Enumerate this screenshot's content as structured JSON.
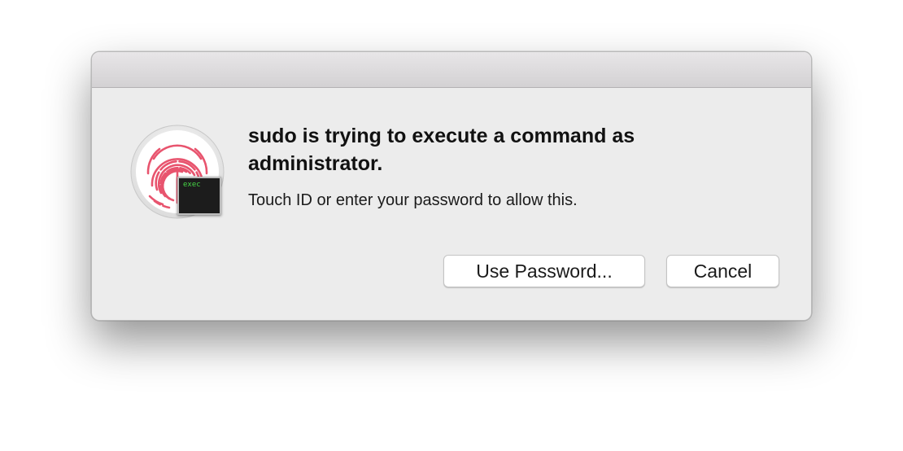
{
  "dialog": {
    "title": "sudo is trying to execute a command as administrator.",
    "message": "Touch ID or enter your password to allow this.",
    "icon": {
      "name": "touch-id-fingerprint-icon",
      "badge_name": "terminal-exec-icon",
      "badge_text": "exec"
    },
    "buttons": {
      "use_password": "Use Password...",
      "cancel": "Cancel"
    },
    "colors": {
      "fingerprint": "#e8546e",
      "background": "#ececec"
    }
  }
}
